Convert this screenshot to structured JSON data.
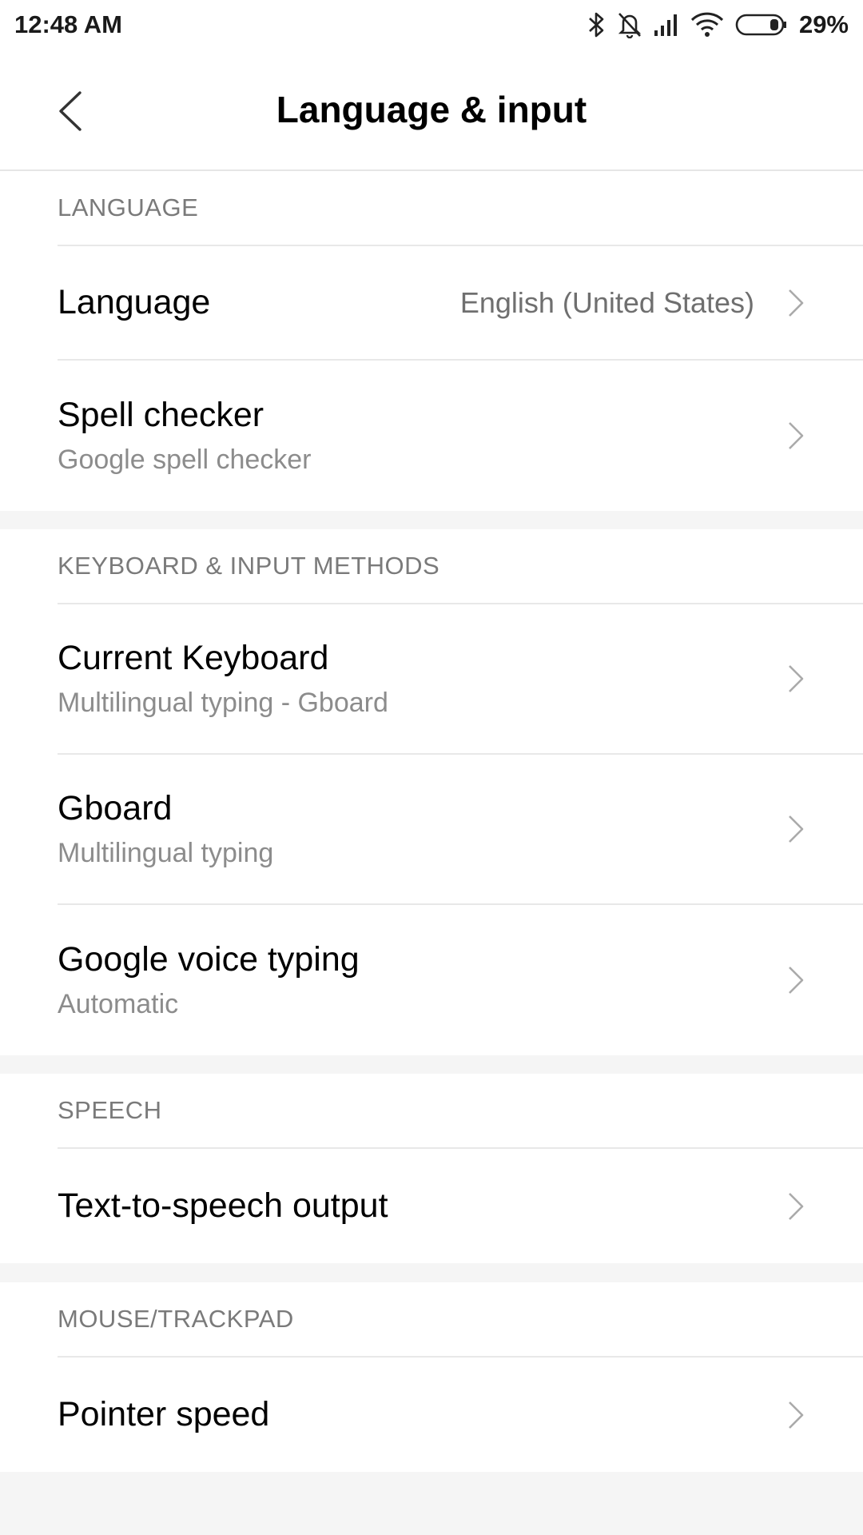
{
  "status_bar": {
    "time": "12:48 AM",
    "battery": "29%",
    "icons": [
      "bluetooth-icon",
      "bell-off-icon",
      "signal-icon",
      "wifi-icon",
      "battery-icon"
    ]
  },
  "header": {
    "title": "Language & input"
  },
  "sections": {
    "language": {
      "header": "LANGUAGE",
      "language": {
        "title": "Language",
        "value": "English (United States)"
      },
      "spell_checker": {
        "title": "Spell checker",
        "subtitle": "Google spell checker"
      }
    },
    "keyboard": {
      "header": "KEYBOARD & INPUT METHODS",
      "current_keyboard": {
        "title": "Current Keyboard",
        "subtitle": "Multilingual typing - Gboard"
      },
      "gboard": {
        "title": "Gboard",
        "subtitle": "Multilingual typing"
      },
      "voice_typing": {
        "title": "Google voice typing",
        "subtitle": "Automatic"
      }
    },
    "speech": {
      "header": "SPEECH",
      "tts": {
        "title": "Text-to-speech output"
      }
    },
    "mouse": {
      "header": "MOUSE/TRACKPAD",
      "pointer_speed": {
        "title": "Pointer speed"
      }
    }
  },
  "colors": {
    "background": "#f5f5f5",
    "surface": "#ffffff",
    "divider": "#e8e8e8",
    "secondary_text": "#8c8c8c"
  }
}
